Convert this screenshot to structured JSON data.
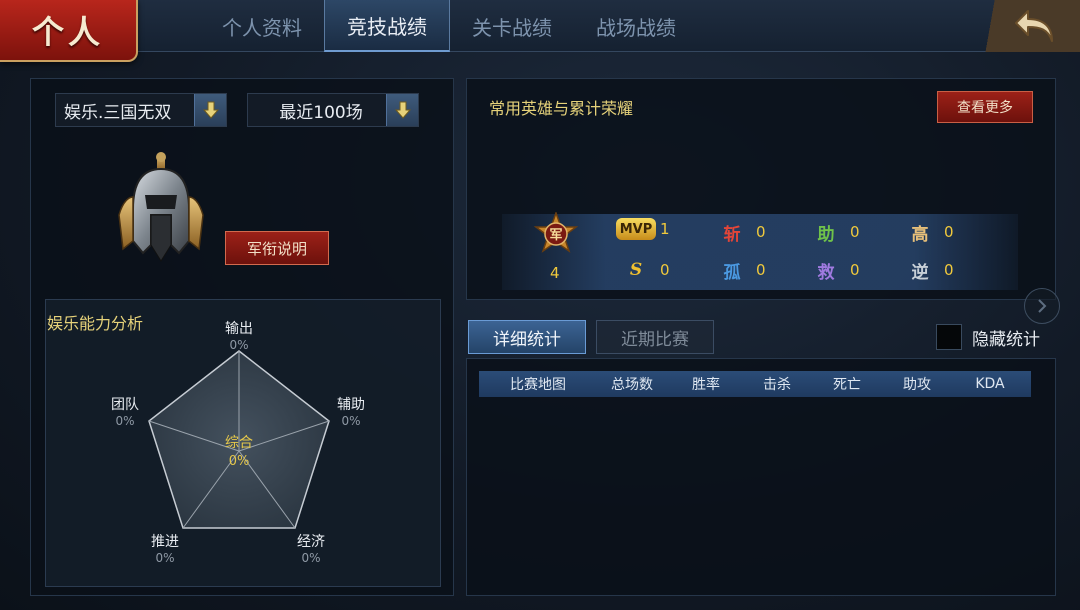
{
  "header": {
    "home_label": "个人",
    "tabs": [
      {
        "label": "个人资料"
      },
      {
        "label": "竞技战绩"
      },
      {
        "label": "关卡战绩"
      },
      {
        "label": "战场战绩"
      }
    ],
    "active_tab": "竞技战绩"
  },
  "left": {
    "mode_select": {
      "value": "娱乐.三国无双"
    },
    "range_select": {
      "value": "最近100场"
    },
    "rank_button_label": "军衔说明",
    "ability": {
      "title": "娱乐能力分析",
      "center_label": "综合",
      "center_value": "0%",
      "axes": [
        {
          "label": "输出",
          "value": "0%"
        },
        {
          "label": "辅助",
          "value": "0%"
        },
        {
          "label": "经济",
          "value": "0%"
        },
        {
          "label": "推进",
          "value": "0%"
        },
        {
          "label": "团队",
          "value": "0%"
        }
      ]
    }
  },
  "right": {
    "honor": {
      "title": "常用英雄与累计荣耀",
      "more_button_label": "查看更多",
      "rank_medal_char": "军",
      "rank_count": "4",
      "items": [
        {
          "icon": "MVP",
          "value": "1",
          "color": "#f0c030"
        },
        {
          "icon": "斩",
          "value": "0",
          "color": "#e0403a"
        },
        {
          "icon": "助",
          "value": "0",
          "color": "#6fc24a"
        },
        {
          "icon": "高",
          "value": "0",
          "color": "#e8c07a"
        },
        {
          "icon": "S",
          "value": "0",
          "color": "#f0c030"
        },
        {
          "icon": "孤",
          "value": "0",
          "color": "#4a98e0"
        },
        {
          "icon": "救",
          "value": "0",
          "color": "#a07ae0"
        },
        {
          "icon": "逆",
          "value": "0",
          "color": "#c8d0d8"
        }
      ]
    },
    "sub_tabs": [
      {
        "label": "详细统计"
      },
      {
        "label": "近期比赛"
      }
    ],
    "active_sub_tab": "详细统计",
    "hide_stats_label": "隐藏统计",
    "hide_stats_checked": false,
    "table": {
      "columns": [
        "比赛地图",
        "总场数",
        "胜率",
        "击杀",
        "死亡",
        "助攻",
        "KDA"
      ],
      "rows": []
    }
  },
  "colors": {
    "accent_gold": "#e6d27a",
    "value_gold": "#f0c93c",
    "button_red": "#9c2118",
    "tab_blue": "#3c6494"
  }
}
